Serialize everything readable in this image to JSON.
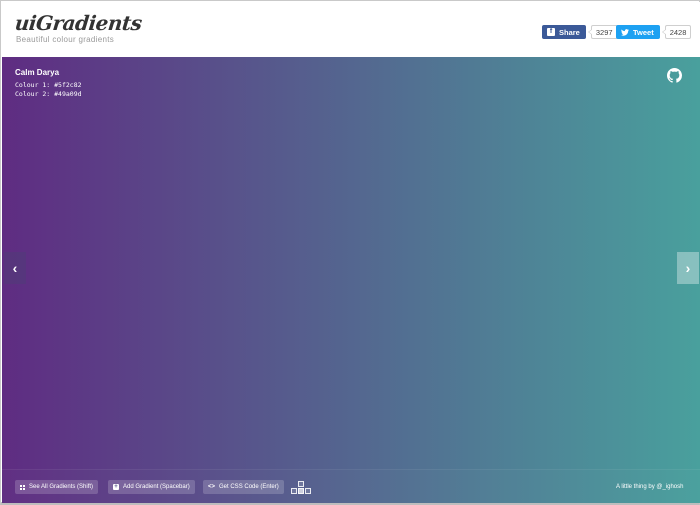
{
  "header": {
    "logo": "uiGradients",
    "tagline": "Beautiful colour gradients",
    "facebook": {
      "label": "Share",
      "count": "3297",
      "color": "#3b5998"
    },
    "twitter": {
      "label": "Tweet",
      "count": "2428",
      "color": "#1da1f2"
    }
  },
  "gradient": {
    "name": "Calm Darya",
    "colour1_text": "Colour 1: #5f2c82",
    "colour2_text": "Colour 2: #49a09d",
    "colour1": "#5f2c82",
    "colour2": "#49a09d"
  },
  "nav": {
    "prev_glyph": "‹",
    "next_glyph": "›",
    "github_icon": "github-icon"
  },
  "footer": {
    "see_all": "See All Gradients (Shift)",
    "add": "Add Gradient (Spacebar)",
    "css": "Get CSS Code (Enter)",
    "css_glyph": "<>",
    "credit": "A little thing by @_ighosh"
  }
}
